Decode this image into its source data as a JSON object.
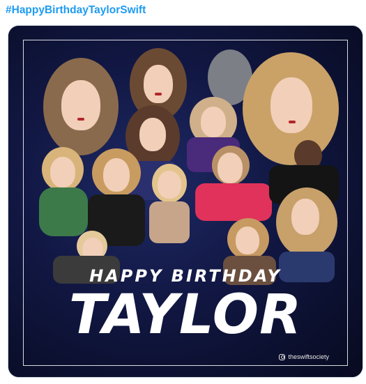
{
  "tweet": {
    "hashtag": "#HappyBirthdayTaylorSwift"
  },
  "poster": {
    "headline_small": "HAPPY BIRTHDAY",
    "headline_large": "TAYLOR",
    "credit": "theswiftsociety",
    "credit_icon": "instagram-icon"
  },
  "colors": {
    "hashtag": "#1d9bf0",
    "poster_background": "#0d1233",
    "text": "#ffffff"
  }
}
